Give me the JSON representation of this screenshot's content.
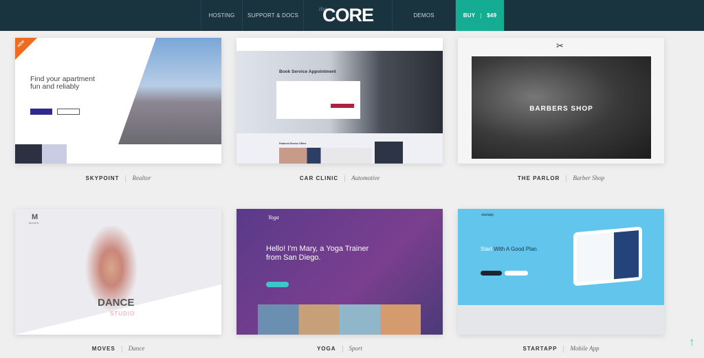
{
  "header": {
    "nav": [
      "HOSTING",
      "SUPPORT & DOCS"
    ],
    "logo_small": "the",
    "logo": "CORE",
    "demos": "DEMOS",
    "buy": "BUY",
    "price": "$49"
  },
  "colors": {
    "header": "#19343f",
    "accent": "#15ac94",
    "background": "#efefef"
  },
  "demos": [
    {
      "name": "SKYPOINT",
      "category": "Realtor",
      "badge": "NEW",
      "headline": "Find your apartment fun and reliably"
    },
    {
      "name": "CAR CLINIC",
      "category": "Automotive",
      "headline": "Book Service Appointment",
      "sub": "Featured Service Offers"
    },
    {
      "name": "THE PARLOR",
      "category": "Barber Shop",
      "headline": "BARBERS SHOP"
    },
    {
      "name": "MOVES",
      "category": "Dance",
      "logo": "M",
      "logo_text": "MOVES",
      "headline": "DANCE",
      "sub": "STUDIO"
    },
    {
      "name": "YOGA",
      "category": "Sport",
      "logo": "Yoga",
      "headline": "Hello! I'm Mary, a Yoga Trainer from San Diego."
    },
    {
      "name": "STARTAPP",
      "category": "Mobile App",
      "logo": "startapp",
      "headline_accent": "Start",
      "headline": "With A Good Plan"
    }
  ],
  "scroll_top_icon": "arrow-up-icon"
}
